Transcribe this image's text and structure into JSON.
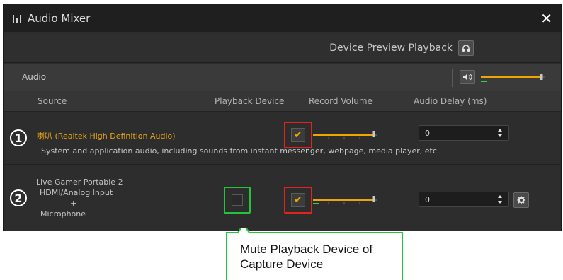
{
  "window": {
    "title": "Audio Mixer",
    "close_label": "✕"
  },
  "preview": {
    "label": "Device Preview Playback"
  },
  "audio": {
    "label": "Audio",
    "master_volume": 0.95
  },
  "columns": {
    "source": "Source",
    "playback_device": "Playback Device",
    "record_volume": "Record Volume",
    "audio_delay": "Audio Delay (ms)"
  },
  "sources": [
    {
      "badge": "1",
      "name": "喇叭 (Realtek High Definition Audio)",
      "description": "System and application audio, including sounds from instant messenger, webpage, media player, etc.",
      "record_checked": true,
      "record_volume": 0.95,
      "delay": "0"
    },
    {
      "badge": "2",
      "lines": [
        "Live Gamer Portable 2",
        "HDMI/Analog Input",
        "+",
        "Microphone"
      ],
      "playback_checked": false,
      "record_checked": true,
      "record_volume": 0.95,
      "delay": "0"
    }
  ],
  "callout": {
    "text": "Mute Playback Device of Capture Device"
  },
  "colors": {
    "accent": "#f0a500",
    "highlight_red": "#e0241e",
    "highlight_green": "#22c43a",
    "level_green": "#2fd24a",
    "panel": "#2d2d2d"
  }
}
